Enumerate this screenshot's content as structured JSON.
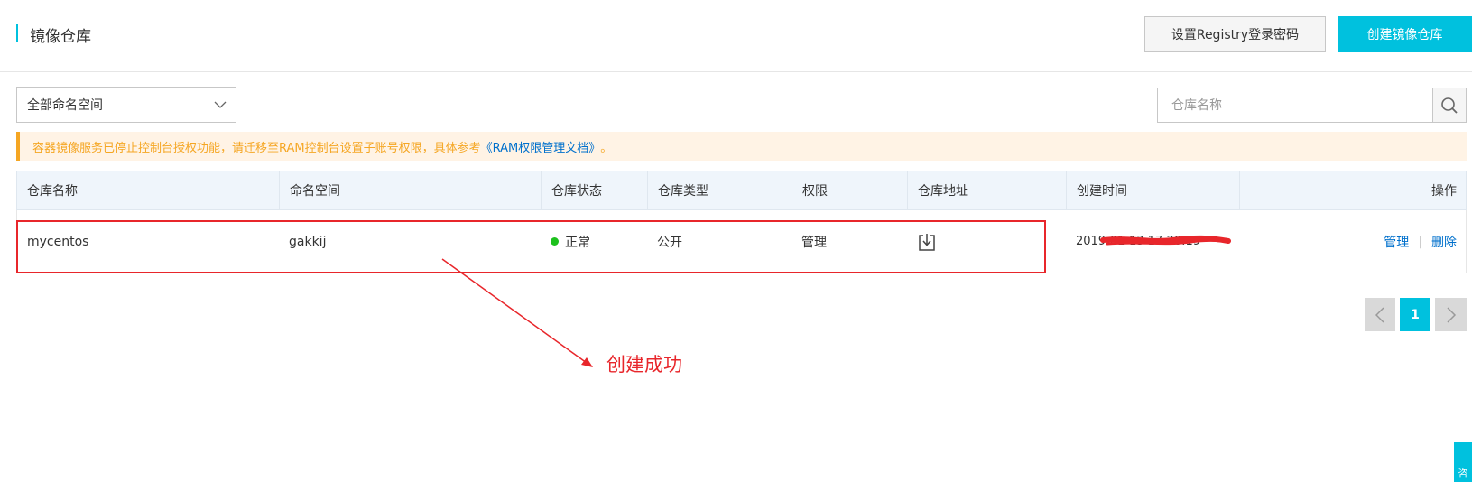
{
  "header": {
    "title": "镜像仓库",
    "set_password_label": "设置Registry登录密码",
    "create_repo_label": "创建镜像仓库"
  },
  "filters": {
    "namespace_selected": "全部命名空间",
    "search_placeholder": "仓库名称"
  },
  "alert": {
    "text": "容器镜像服务已停止控制台授权功能，请迁移至RAM控制台设置子账号权限，具体参考",
    "link_text": "《RAM权限管理文档》",
    "suffix": "。"
  },
  "table": {
    "columns": [
      "仓库名称",
      "命名空间",
      "仓库状态",
      "仓库类型",
      "权限",
      "仓库地址",
      "创建时间",
      "操作"
    ],
    "rows": [
      {
        "name": "mycentos",
        "namespace": "gakkij",
        "status": "正常",
        "type": "公开",
        "permission": "管理",
        "created_time": "2019-01-13 17:20:19",
        "op_manage": "管理",
        "op_separator": "|",
        "op_delete": "删除"
      }
    ]
  },
  "pagination": {
    "current_page": "1"
  },
  "annotation": {
    "text": "创建成功"
  },
  "help_widget": {
    "text": "咨"
  },
  "colors": {
    "accent": "#00c1de",
    "warning": "#f5a623",
    "link": "#0070cc",
    "annotation_red": "#e8262b",
    "status_ok": "#1dc11d"
  },
  "icons": [
    "chevron-down-icon",
    "search-icon",
    "download-icon",
    "chevron-left-icon",
    "chevron-right-icon",
    "chat-icon"
  ]
}
